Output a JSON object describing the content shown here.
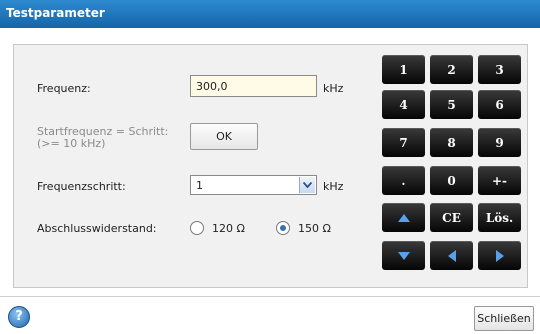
{
  "window": {
    "title": "Testparameter"
  },
  "form": {
    "frequency": {
      "label": "Frequenz:",
      "value": "300,0",
      "unit": "kHz"
    },
    "start_equals_step": {
      "label_line1": "Startfrequenz = Schritt:",
      "label_line2": "(>= 10 kHz)",
      "button_label": "OK"
    },
    "frequency_step": {
      "label": "Frequenzschritt:",
      "selected": "1",
      "unit": "kHz"
    },
    "termination": {
      "label": "Abschlusswiderstand:",
      "options": [
        {
          "label": "120 Ω",
          "checked": false
        },
        {
          "label": "150 Ω",
          "checked": true
        }
      ]
    }
  },
  "keypad": {
    "keys": [
      "1",
      "2",
      "3",
      "4",
      "5",
      "6",
      "7",
      "8",
      "9",
      ".",
      "0",
      "+-",
      "up-arrow",
      "CE",
      "Lös.",
      "down-arrow",
      "left-arrow",
      "right-arrow"
    ],
    "labels": {
      "k1": "1",
      "k2": "2",
      "k3": "3",
      "k4": "4",
      "k5": "5",
      "k6": "6",
      "k7": "7",
      "k8": "8",
      "k9": "9",
      "dot": ".",
      "k0": "0",
      "sign": "+-",
      "ce": "CE",
      "delete": "Lös."
    }
  },
  "footer": {
    "help_label": "?",
    "close_label": "Schließen"
  },
  "colors": {
    "titlebar": "#1e78c0",
    "input_bg": "#fffbe7",
    "key_bg": "#111111",
    "radio_dot": "#3a6fb5"
  }
}
